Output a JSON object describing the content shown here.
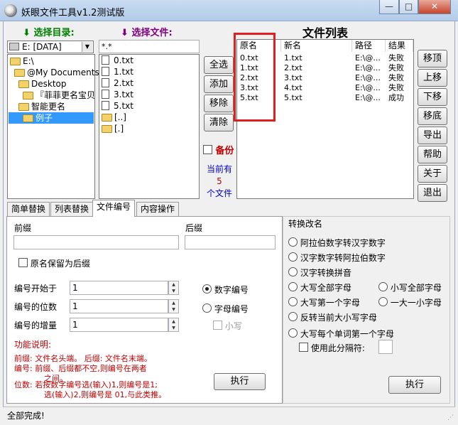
{
  "window": {
    "title": "妖眼文件工具v1.2测试版",
    "controls": {
      "minimize": "—",
      "maximize": "□",
      "close": "✕"
    }
  },
  "left": {
    "dir_label": "选择目录:",
    "file_label": "选择文件:",
    "drive": "E: [DATA]",
    "tree": [
      "E:\\",
      "@My Documents",
      "Desktop",
      "『菲菲更名宝贝",
      "智能更名",
      "例子"
    ],
    "filter": "*.*",
    "files": [
      "0.txt",
      "1.txt",
      "2.txt",
      "3.txt",
      "5.txt",
      "[..]",
      "[.]"
    ],
    "mid_buttons": [
      "全选",
      "添加",
      "移除",
      "清除"
    ],
    "backup_label": "备份",
    "count_text": [
      "当前有",
      "5",
      "个文件"
    ]
  },
  "file_list": {
    "title": "文件列表",
    "columns": [
      "原名",
      "新名",
      "路径",
      "结果"
    ],
    "rows": [
      [
        "0.txt",
        "1.txt",
        "E:\\@...",
        "失败"
      ],
      [
        "1.txt",
        "2.txt",
        "E:\\@...",
        "失败"
      ],
      [
        "2.txt",
        "3.txt",
        "E:\\@...",
        "失败"
      ],
      [
        "3.txt",
        "4.txt",
        "E:\\@...",
        "失败"
      ],
      [
        "5.txt",
        "5.txt",
        "E:\\@...",
        "成功"
      ]
    ]
  },
  "side_buttons": [
    "移顶",
    "上移",
    "下移",
    "移底",
    "导出",
    "帮助",
    "关于",
    "退出"
  ],
  "tabs": [
    "简单替换",
    "列表替换",
    "文件编号",
    "内容操作"
  ],
  "numbering": {
    "prefix_label": "前缀",
    "suffix_label": "后缀",
    "keep_name_label": "原名保留为后缀",
    "start_label": "编号开始于",
    "start_value": "1",
    "digits_label": "编号的位数",
    "digits_value": "1",
    "step_label": "编号的增量",
    "step_value": "1",
    "numeric_label": "数字编号",
    "alpha_label": "字母编号",
    "lower_label": "小写",
    "help_title": "功能说明:",
    "help_lines": [
      "前缀: 文件名头端。  后缀: 文件名末端。",
      "编号: 前缀、后缀都不空,则编号在两者",
      "之间。",
      "位数: 若按数字编号选(输入)1,则编号是1;",
      "选(输入)2,则编号是 01,与此类推。"
    ],
    "exec_label": "执行"
  },
  "convert": {
    "title": "转换改名",
    "options": [
      "阿拉伯数字转汉字数字",
      "汉字数字转阿拉伯数字",
      "汉字转换拼音",
      "大写全部字母",
      "小写全部字母",
      "大写第一个字母",
      "一大一小字母",
      "反转当前大小写字母",
      "大写每个单词第一个字母"
    ],
    "separator_label": "使用此分隔符:",
    "exec_label": "执行"
  },
  "status": "全部完成!",
  "colors": {
    "highlight_box": "#e02020",
    "selection": "#3399ff",
    "label_green": "#008000",
    "label_purple": "#800080"
  }
}
